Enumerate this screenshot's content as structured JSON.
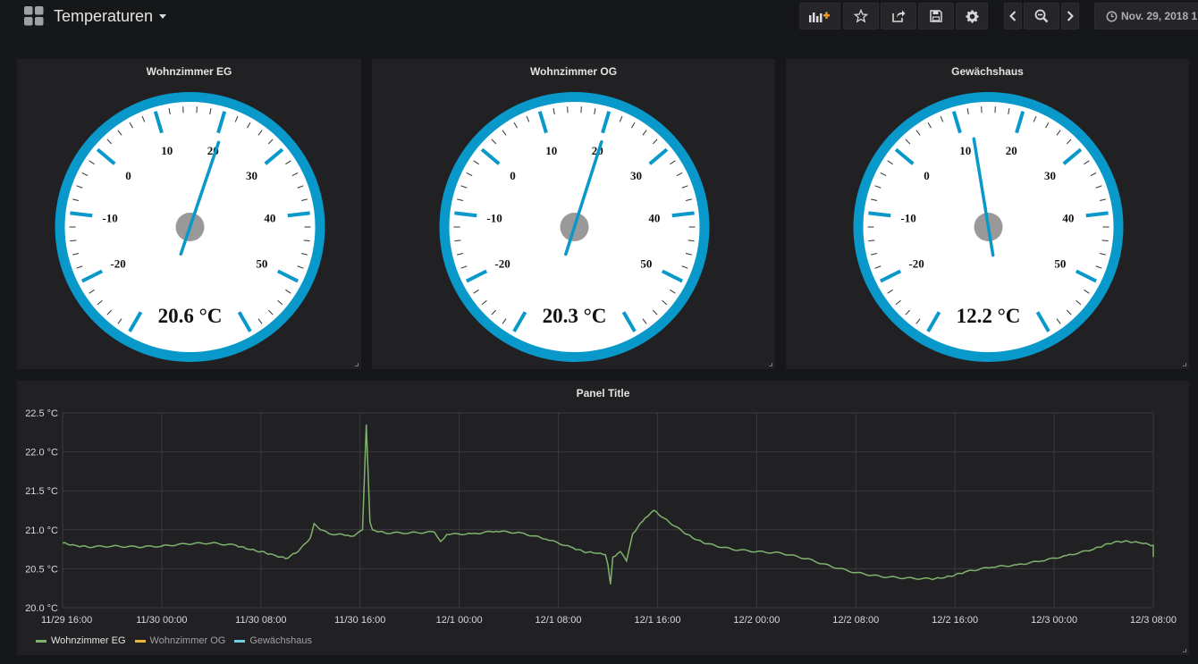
{
  "header": {
    "title": "Temperaturen",
    "time_range": "Nov. 29, 2018 1",
    "icons": [
      "dashboard-grid-icon",
      "add-panel-icon",
      "star-icon",
      "share-icon",
      "save-icon",
      "gear-icon",
      "chevron-left-icon",
      "zoom-out-icon",
      "chevron-right-icon",
      "clock-icon"
    ]
  },
  "gauges": [
    {
      "title": "Wohnzimmer EG",
      "value": 20.6,
      "display": "20.6 °C"
    },
    {
      "title": "Wohnzimmer OG",
      "value": 20.3,
      "display": "20.3 °C"
    },
    {
      "title": "Gewächshaus",
      "value": 12.2,
      "display": "12.2 °C"
    }
  ],
  "gauge_scale": {
    "min": -30,
    "max": 60,
    "major_ticks": [
      -20,
      -10,
      0,
      10,
      20,
      30,
      40,
      50
    ],
    "color": "#0898c9"
  },
  "graph": {
    "title": "Panel Title"
  },
  "chart_data": {
    "type": "line",
    "title": "Panel Title",
    "y_ticks": [
      "22.5 °C",
      "22.0 °C",
      "21.5 °C",
      "21.0 °C",
      "20.5 °C",
      "20.0 °C"
    ],
    "ylim": [
      20.0,
      22.5
    ],
    "x_ticks": [
      "11/29 16:00",
      "11/30 00:00",
      "11/30 08:00",
      "11/30 16:00",
      "12/1 00:00",
      "12/1 08:00",
      "12/1 16:00",
      "12/2 00:00",
      "12/2 08:00",
      "12/2 16:00",
      "12/3 00:00",
      "12/3 08:00"
    ],
    "x_range_hours": [
      0,
      88
    ],
    "grid": true,
    "legend_position": "bottom-left",
    "series": [
      {
        "name": "Wohnzimmer EG",
        "color": "#7eb26d",
        "points": [
          [
            0,
            20.83
          ],
          [
            1,
            20.8
          ],
          [
            2,
            20.78
          ],
          [
            4,
            20.79
          ],
          [
            6,
            20.78
          ],
          [
            8,
            20.79
          ],
          [
            10,
            20.82
          ],
          [
            12,
            20.83
          ],
          [
            14,
            20.8
          ],
          [
            15,
            20.75
          ],
          [
            16,
            20.72
          ],
          [
            17,
            20.68
          ],
          [
            18,
            20.63
          ],
          [
            19,
            20.72
          ],
          [
            20,
            20.9
          ],
          [
            20.3,
            21.08
          ],
          [
            20.8,
            21.0
          ],
          [
            21.5,
            20.95
          ],
          [
            23,
            20.93
          ],
          [
            23.5,
            20.92
          ],
          [
            24.2,
            21.0
          ],
          [
            24.5,
            22.35
          ],
          [
            24.8,
            21.1
          ],
          [
            25,
            21.0
          ],
          [
            26,
            20.96
          ],
          [
            28,
            20.96
          ],
          [
            30,
            20.97
          ],
          [
            30.5,
            20.85
          ],
          [
            31,
            20.94
          ],
          [
            33,
            20.95
          ],
          [
            35,
            20.98
          ],
          [
            37,
            20.96
          ],
          [
            39,
            20.88
          ],
          [
            41,
            20.78
          ],
          [
            42,
            20.72
          ],
          [
            43,
            20.7
          ],
          [
            43.8,
            20.68
          ],
          [
            44,
            20.55
          ],
          [
            44.2,
            20.3
          ],
          [
            44.4,
            20.65
          ],
          [
            45,
            20.72
          ],
          [
            45.5,
            20.6
          ],
          [
            46,
            20.95
          ],
          [
            47,
            21.15
          ],
          [
            47.7,
            21.25
          ],
          [
            48.5,
            21.15
          ],
          [
            50,
            20.98
          ],
          [
            51,
            20.88
          ],
          [
            52,
            20.82
          ],
          [
            54,
            20.75
          ],
          [
            56,
            20.72
          ],
          [
            58,
            20.7
          ],
          [
            60,
            20.63
          ],
          [
            62,
            20.53
          ],
          [
            64,
            20.45
          ],
          [
            66,
            20.4
          ],
          [
            68,
            20.38
          ],
          [
            70,
            20.37
          ],
          [
            71,
            20.38
          ],
          [
            72,
            20.42
          ],
          [
            73,
            20.47
          ],
          [
            75,
            20.52
          ],
          [
            77,
            20.55
          ],
          [
            79,
            20.6
          ],
          [
            81,
            20.67
          ],
          [
            83,
            20.74
          ],
          [
            84,
            20.8
          ],
          [
            85,
            20.85
          ],
          [
            86,
            20.85
          ],
          [
            87,
            20.83
          ],
          [
            88,
            20.8
          ],
          [
            88.5,
            20.75
          ],
          [
            89,
            20.7
          ],
          [
            90,
            20.68
          ],
          [
            91.5,
            20.65
          ]
        ]
      },
      {
        "name": "Wohnzimmer OG",
        "color": "#eab839",
        "points": []
      },
      {
        "name": "Gewächshaus",
        "color": "#6ed0e0",
        "points": []
      }
    ]
  }
}
